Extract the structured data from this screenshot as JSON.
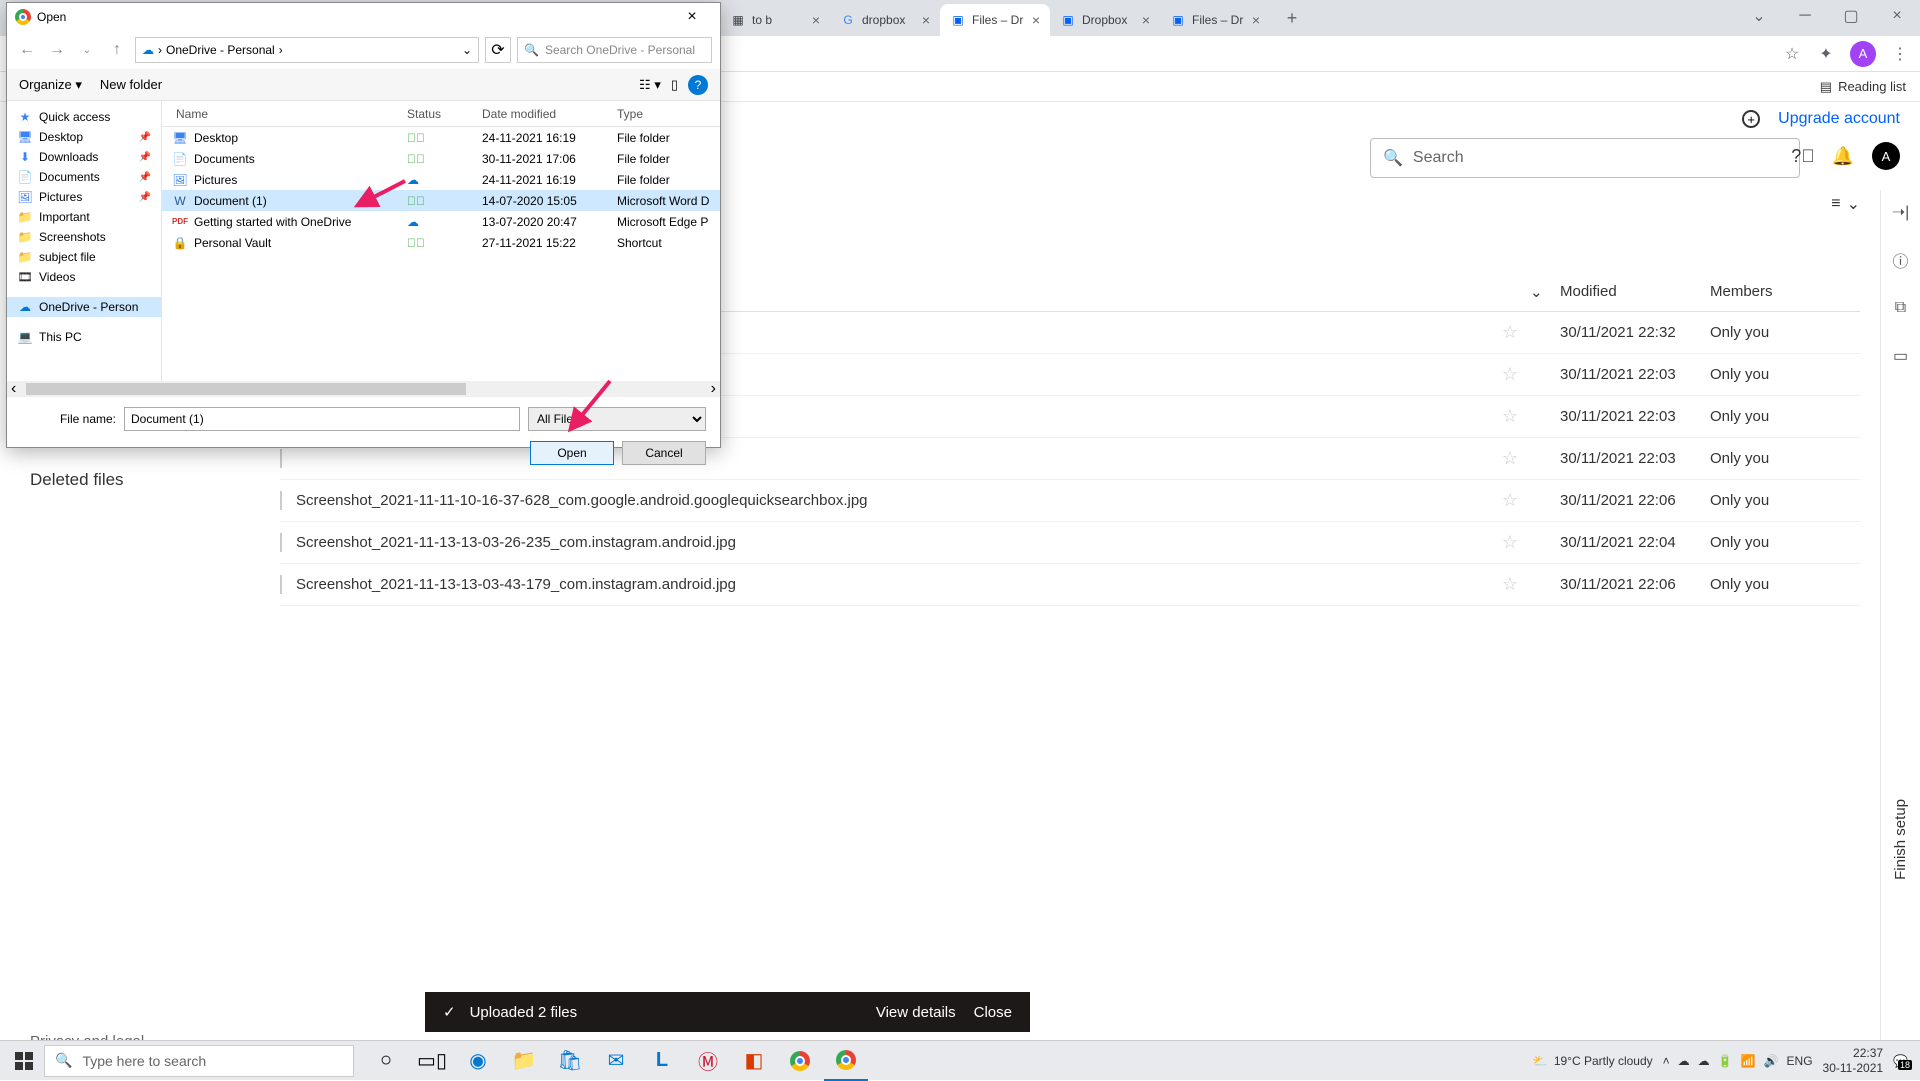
{
  "browser": {
    "tabs": [
      {
        "title": "to b",
        "icon": "generic"
      },
      {
        "title": "dropbox",
        "icon": "google"
      },
      {
        "title": "Files – Dr",
        "icon": "dropbox",
        "active": true
      },
      {
        "title": "Dropbox",
        "icon": "dropbox"
      },
      {
        "title": "Files – Dr",
        "icon": "dropbox"
      }
    ],
    "reading_list": "Reading list",
    "avatar_letter": "A"
  },
  "dropbox": {
    "upgrade": "Upgrade account",
    "search_placeholder": "Search",
    "avatar_letter": "A",
    "columns": {
      "modified": "Modified",
      "members": "Members"
    },
    "rows": [
      {
        "name": "",
        "modified": "30/11/2021 22:32",
        "members": "Only you"
      },
      {
        "name": "",
        "modified": "30/11/2021 22:03",
        "members": "Only you"
      },
      {
        "name": "",
        "modified": "30/11/2021 22:03",
        "members": "Only you"
      },
      {
        "name": "",
        "modified": "30/11/2021 22:03",
        "members": "Only you"
      },
      {
        "name": "Screenshot_2021-11-11-10-16-37-628_com.google.android.googlequicksearchbox.jpg",
        "modified": "30/11/2021 22:06",
        "members": "Only you"
      },
      {
        "name": "Screenshot_2021-11-13-13-03-26-235_com.instagram.android.jpg",
        "modified": "30/11/2021 22:04",
        "members": "Only you"
      },
      {
        "name": "Screenshot_2021-11-13-13-03-43-179_com.instagram.android.jpg",
        "modified": "30/11/2021 22:06",
        "members": "Only you"
      }
    ],
    "deleted_files": "Deleted files",
    "privacy": "Privacy and legal",
    "finish_setup": "Finish setup",
    "toast": {
      "text": "Uploaded 2 files",
      "view": "View details",
      "close": "Close"
    }
  },
  "dialog": {
    "title": "Open",
    "path_parts": [
      "OneDrive - Personal"
    ],
    "search_placeholder": "Search OneDrive - Personal",
    "organize": "Organize",
    "new_folder": "New folder",
    "columns": {
      "name": "Name",
      "status": "Status",
      "date": "Date modified",
      "type": "Type"
    },
    "tree": [
      {
        "label": "Quick access",
        "icon": "star"
      },
      {
        "label": "Desktop",
        "icon": "desktop",
        "pinned": true
      },
      {
        "label": "Downloads",
        "icon": "download",
        "pinned": true
      },
      {
        "label": "Documents",
        "icon": "doc",
        "pinned": true
      },
      {
        "label": "Pictures",
        "icon": "pic",
        "pinned": true
      },
      {
        "label": "Important",
        "icon": "folder"
      },
      {
        "label": "Screenshots",
        "icon": "folder"
      },
      {
        "label": "subject file",
        "icon": "folder"
      },
      {
        "label": "Videos",
        "icon": "video"
      },
      {
        "label": "OneDrive - Person",
        "icon": "cloud",
        "selected": true
      },
      {
        "label": "This PC",
        "icon": "pc"
      }
    ],
    "files": [
      {
        "name": "Desktop",
        "status": "sync",
        "date": "24-11-2021 16:19",
        "type": "File folder",
        "icon": "desktop"
      },
      {
        "name": "Documents",
        "status": "sync",
        "date": "30-11-2021 17:06",
        "type": "File folder",
        "icon": "doc"
      },
      {
        "name": "Pictures",
        "status": "cloud",
        "date": "24-11-2021 16:19",
        "type": "File folder",
        "icon": "pic"
      },
      {
        "name": "Document (1)",
        "status": "sync",
        "date": "14-07-2020 15:05",
        "type": "Microsoft Word D",
        "icon": "word",
        "selected": true
      },
      {
        "name": "Getting started with OneDrive",
        "status": "cloud",
        "date": "13-07-2020 20:47",
        "type": "Microsoft Edge P",
        "icon": "pdf"
      },
      {
        "name": "Personal Vault",
        "status": "sync",
        "date": "27-11-2021 15:22",
        "type": "Shortcut",
        "icon": "vault"
      }
    ],
    "file_name_label": "File name:",
    "file_name_value": "Document (1)",
    "filter": "All Files",
    "open_btn": "Open",
    "cancel_btn": "Cancel"
  },
  "taskbar": {
    "search_placeholder": "Type here to search",
    "weather": "19°C  Partly cloudy",
    "lang": "ENG",
    "time": "22:37",
    "date": "30-11-2021",
    "notif_badge": "18"
  }
}
